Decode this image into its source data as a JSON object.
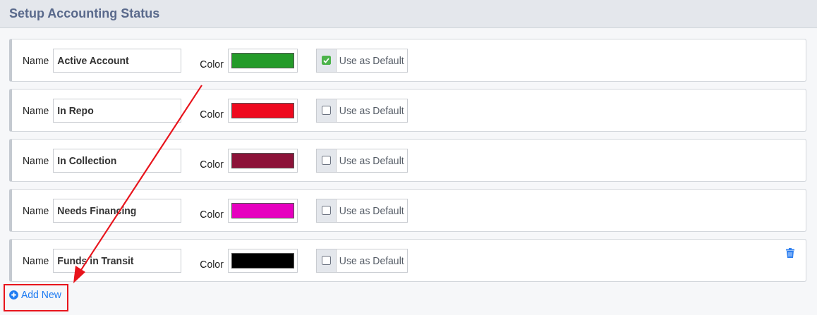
{
  "header": {
    "title": "Setup Accounting Status"
  },
  "statuses": [
    {
      "name_label": "Name",
      "name": "Active Account",
      "color_label": "Color",
      "color": "#259b2a",
      "default_label": "Use as Default",
      "checked": true,
      "deletable": false
    },
    {
      "name_label": "Name",
      "name": "In Repo",
      "color_label": "Color",
      "color": "#ee0a1f",
      "default_label": "Use as Default",
      "checked": false,
      "deletable": false
    },
    {
      "name_label": "Name",
      "name": "In Collection",
      "color_label": "Color",
      "color": "#8c1339",
      "default_label": "Use as Default",
      "checked": false,
      "deletable": false
    },
    {
      "name_label": "Name",
      "name": "Needs Financing",
      "color_label": "Color",
      "color": "#e600bf",
      "default_label": "Use as Default",
      "checked": false,
      "deletable": false
    },
    {
      "name_label": "Name",
      "name": "Funds in Transit",
      "color_label": "Color",
      "color": "#000000",
      "default_label": "Use as Default",
      "checked": false,
      "deletable": true
    }
  ],
  "add_button": {
    "label": "Add New"
  }
}
